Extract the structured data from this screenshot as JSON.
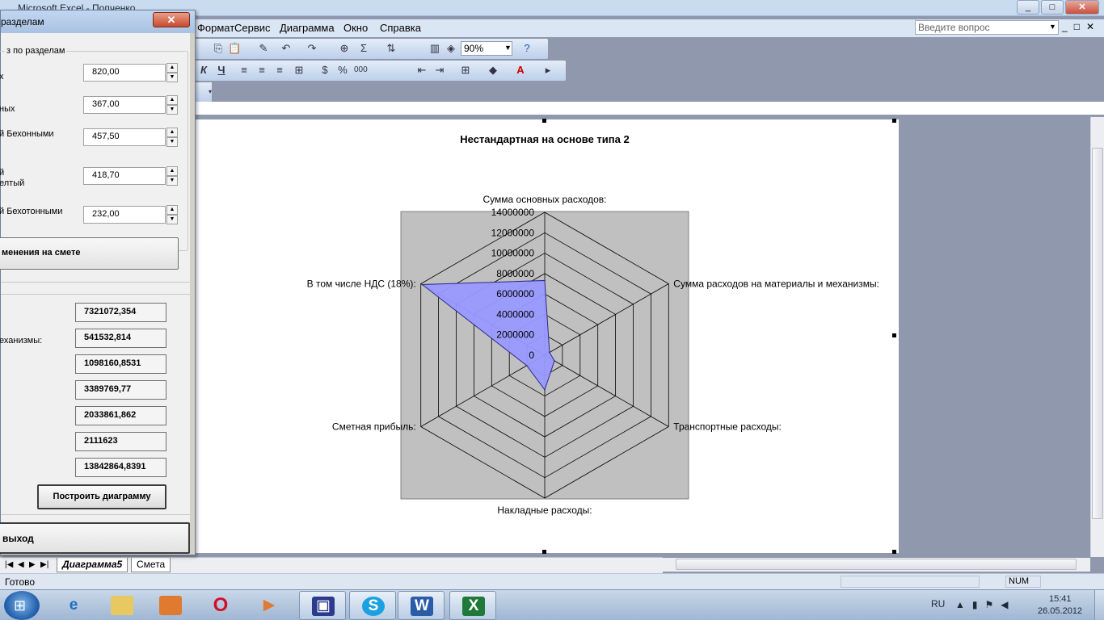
{
  "window": {
    "title": "Microsoft Excel - Попченко",
    "controls": [
      "_",
      "□",
      "✕"
    ]
  },
  "menu": {
    "items": [
      "Формат",
      "Сервис",
      "Диаграмма",
      "Окно",
      "Справка"
    ],
    "ask_placeholder": "Введите вопрос",
    "doc_controls": [
      "_",
      "□",
      "✕"
    ]
  },
  "toolbar": {
    "zoom": "90%",
    "buttons": [
      "copy-icon",
      "paste-icon",
      "format-painter-icon",
      "undo-icon",
      "redo-icon",
      "hyperlink-icon",
      "autosum-icon",
      "sort-icon",
      "chart-wizard-icon",
      "drawing-icon",
      "help-icon"
    ],
    "format_buttons": {
      "italic": "К",
      "underline": "Ч",
      "percent": "%",
      "thousands": "000",
      "font_color": "A"
    }
  },
  "dialog": {
    "title": "разделам",
    "close": "✕",
    "group_legend": "з по разделам",
    "inputs": [
      {
        "label": "х",
        "value": "820,00"
      },
      {
        "label": "ных",
        "value": "367,00"
      },
      {
        "label": "й Бехонными",
        "value": "457,50"
      },
      {
        "label": "й\nелтый",
        "value": "418,70"
      },
      {
        "label": "й Бехотонными",
        "value": "232,00"
      }
    ],
    "apply_label": "менения на смете",
    "results": [
      {
        "label": "",
        "value": "7321072,354"
      },
      {
        "label": "еханизмы:",
        "value": "541532,814"
      },
      {
        "label": "",
        "value": "1098160,8531"
      },
      {
        "label": "",
        "value": "3389769,77"
      },
      {
        "label": "",
        "value": "2033861,862"
      },
      {
        "label": "",
        "value": "2111623"
      },
      {
        "label": "",
        "value": "13842864,8391"
      }
    ],
    "build_label": "Построить диаграмму",
    "exit_label": "выход"
  },
  "chart_data": {
    "type": "radar",
    "title": "Нестандартная на основе типа 2",
    "categories": [
      "Сумма основных расходов:",
      "Сумма расходов на материалы и механизмы:",
      "Транспортные расходы:",
      "Накладные расходы:",
      "Сметная прибыль:",
      "В том числе НДС (18%):"
    ],
    "series": [
      {
        "values": [
          7321072.354,
          541532.814,
          1098160.8531,
          3389769.77,
          2033861.862,
          13842864.8391
        ],
        "color": "#9999ff"
      }
    ],
    "ylim": [
      0,
      14000000
    ],
    "ticks": [
      "0",
      "2000000",
      "4000000",
      "6000000",
      "8000000",
      "10000000",
      "12000000",
      "14000000"
    ],
    "plot_bg": "#c0c0c0"
  },
  "sheets": {
    "nav": [
      "|◀",
      "◀",
      "▶",
      "▶|"
    ],
    "tabs": [
      "Диаграмма5",
      "Смета"
    ],
    "active": "Диаграмма5"
  },
  "status": {
    "text": "Готово",
    "num": "NUM"
  },
  "taskbar": {
    "lang": "RU",
    "time": "15:41",
    "date": "26.05.2012"
  }
}
